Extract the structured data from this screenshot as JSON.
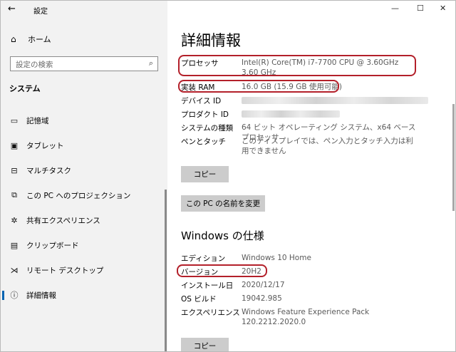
{
  "window": {
    "title": "設定",
    "minimize": "—",
    "maximize": "☐",
    "close": "✕"
  },
  "sidebar": {
    "home": "ホーム",
    "search_placeholder": "設定の検索",
    "section": "システム",
    "items": [
      {
        "label": "記憶域",
        "icon": "storage-icon"
      },
      {
        "label": "タブレット",
        "icon": "tablet-icon"
      },
      {
        "label": "マルチタスク",
        "icon": "multitask-icon"
      },
      {
        "label": "この PC へのプロジェクション",
        "icon": "projection-icon"
      },
      {
        "label": "共有エクスペリエンス",
        "icon": "shared-experience-icon"
      },
      {
        "label": "クリップボード",
        "icon": "clipboard-icon"
      },
      {
        "label": "リモート デスクトップ",
        "icon": "remote-desktop-icon"
      },
      {
        "label": "詳細情報",
        "icon": "info-icon",
        "active": true
      }
    ]
  },
  "main": {
    "title": "詳細情報",
    "device_specs": [
      {
        "label": "プロセッサ",
        "value": "Intel(R) Core(TM) i7-7700 CPU @ 3.60GHz   3.60 GHz"
      },
      {
        "label": "実装 RAM",
        "value": "16.0 GB (15.9 GB 使用可能)"
      },
      {
        "label": "デバイス ID",
        "value": ""
      },
      {
        "label": "プロダクト ID",
        "value": ""
      },
      {
        "label": "システムの種類",
        "value": "64 ビット オペレーティング システム、x64 ベース プロセッサ"
      },
      {
        "label": "ペンとタッチ",
        "value": "このディスプレイでは、ペン入力とタッチ入力は利用できません"
      }
    ],
    "copy_button": "コピー",
    "rename_button": "この PC の名前を変更",
    "windows_spec_title": "Windows の仕様",
    "windows_specs": [
      {
        "label": "エディション",
        "value": "Windows 10 Home"
      },
      {
        "label": "バージョン",
        "value": "20H2"
      },
      {
        "label": "インストール日",
        "value": "2020/12/17"
      },
      {
        "label": "OS ビルド",
        "value": "19042.985"
      },
      {
        "label": "エクスペリエンス",
        "value": "Windows Feature Experience Pack 120.2212.2020.0"
      }
    ],
    "copy_button_2": "コピー"
  },
  "highlight_color": "#b3202a",
  "accent_color": "#0063b1"
}
